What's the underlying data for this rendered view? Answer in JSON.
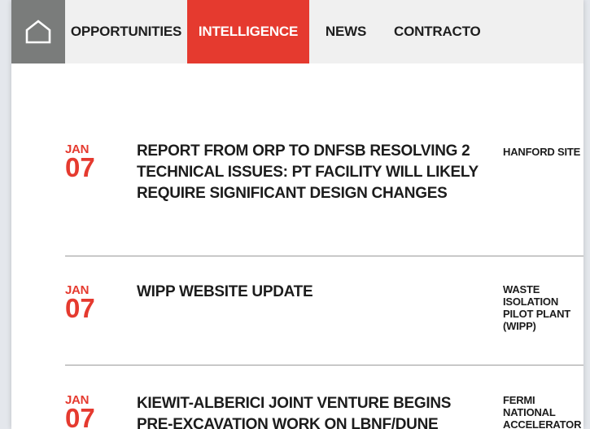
{
  "nav": {
    "home_icon": "home-icon",
    "items": [
      {
        "label": "OPPORTUNITIES",
        "active": false
      },
      {
        "label": "INTELLIGENCE",
        "active": true
      },
      {
        "label": "NEWS",
        "active": false
      },
      {
        "label": "CONTRACTO",
        "active": false
      }
    ]
  },
  "colors": {
    "accent": "#e53a2f",
    "nav_bg": "#f0f0f0",
    "home_bg": "#7a7c7b",
    "text": "#1c1c1c"
  },
  "articles": [
    {
      "month": "JAN",
      "day": "07",
      "title": "REPORT FROM ORP TO DNFSB RESOLVING 2 TECHNICAL ISSUES: PT FACILITY WILL LIKELY REQUIRE SIGNIFICANT DESIGN CHANGES",
      "site": "HANFORD SITE"
    },
    {
      "month": "JAN",
      "day": "07",
      "title": "WIPP WEBSITE UPDATE",
      "site": "WASTE ISOLATION PILOT PLANT (WIPP)"
    },
    {
      "month": "JAN",
      "day": "07",
      "title": "KIEWIT-ALBERICI JOINT VENTURE BEGINS PRE-EXCAVATION WORK ON LBNF/DUNE",
      "site": "FERMI NATIONAL ACCELERATOR"
    }
  ]
}
